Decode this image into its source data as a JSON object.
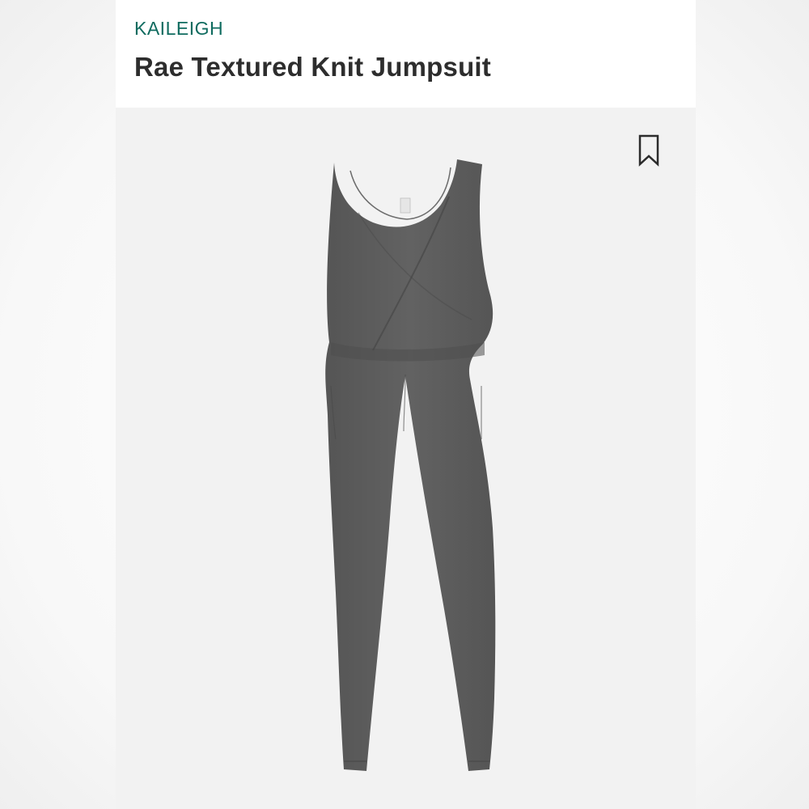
{
  "product": {
    "brand": "KAILEIGH",
    "name": "Rae Textured Knit Jumpsuit",
    "image_alt": "jumpsuit-image"
  },
  "icons": {
    "bookmark": "bookmark-icon"
  },
  "colors": {
    "brand": "#0f6b5f",
    "title": "#2d2d2d",
    "garment": "#5a5a5a",
    "background": "#f2f2f2"
  }
}
